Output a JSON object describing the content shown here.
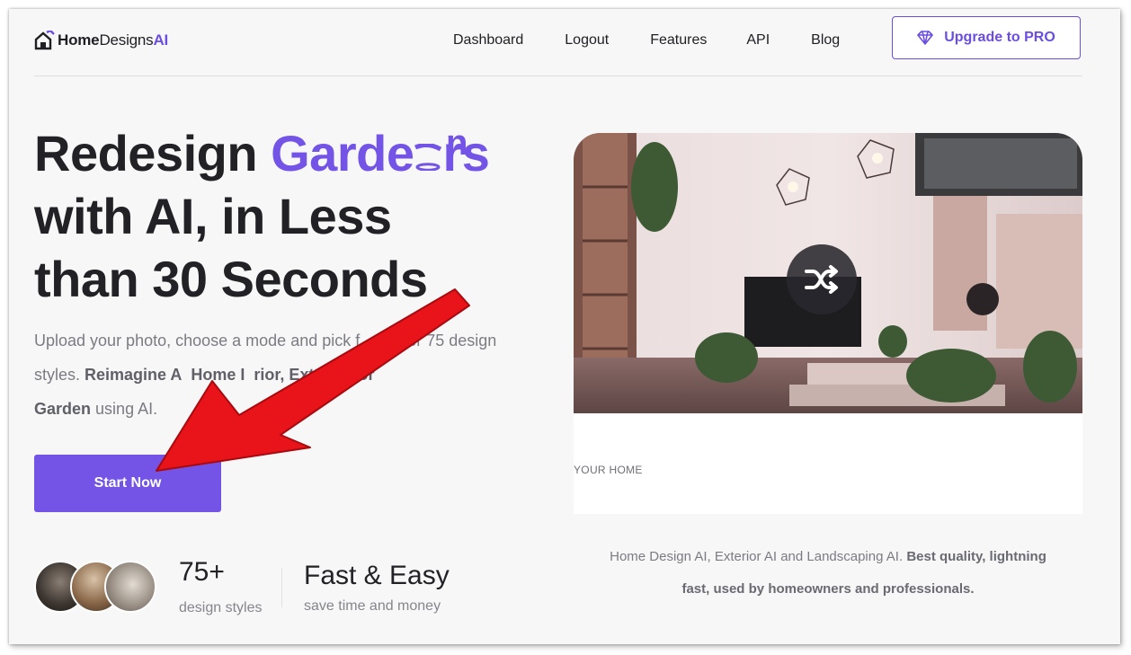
{
  "logo": {
    "part1": "Home",
    "part2": "Designs",
    "part3": "AI"
  },
  "nav": [
    "Dashboard",
    "Logout",
    "Features",
    "API",
    "Blog"
  ],
  "upgrade_label": "Upgrade to PRO",
  "headline": {
    "word1": "Redesign",
    "accent": "Garde",
    "accent_tail": "rs",
    "floating_letter": "n",
    "line2": "with AI, in Less",
    "line3": "than 30 Seconds"
  },
  "subtext": {
    "part1": "Upload your photo, choose a mode and pick f",
    "part2": "over 75 design styles.",
    "bold1": "Reimagine A",
    "bold2": "Home I",
    "bold3": "rior, Exterior, or",
    "bold4": "Garden",
    "part3": "using AI."
  },
  "start_label": "Start Now",
  "stats": {
    "count": "75+",
    "count_label": "design styles",
    "fast_title": "Fast & Easy",
    "fast_label": "save time and money"
  },
  "preview": {
    "caption": "YOUR HOME"
  },
  "tagline": {
    "plain": "Home Design AI, Exterior AI and Landscaping AI.",
    "bold1": "Best quality, lightning",
    "bold2": "fast, used by homeowners and professionals."
  },
  "colors": {
    "accent": "#7354e6",
    "arrow": "#e8141a"
  }
}
